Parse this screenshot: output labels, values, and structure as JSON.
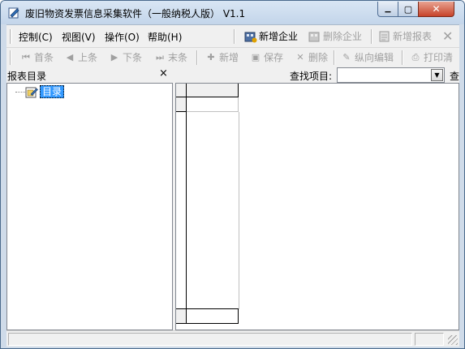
{
  "window": {
    "title": "废旧物资发票信息采集软件（一般纳税人版） V1.1",
    "caption_buttons": {
      "minimize": "▁",
      "maximize": "▢",
      "close": "✕"
    }
  },
  "menu": [
    {
      "label": "控制(C)"
    },
    {
      "label": "视图(V)"
    },
    {
      "label": "操作(O)"
    },
    {
      "label": "帮助(H)"
    }
  ],
  "toolbar1": [
    {
      "label": "新增企业",
      "icon": "new-company-icon",
      "enabled": true
    },
    {
      "label": "删除企业",
      "icon": "delete-company-icon",
      "enabled": false
    },
    {
      "label": "新增报表",
      "icon": "new-report-icon",
      "enabled": false
    },
    {
      "label": "✕",
      "icon": "close-icon",
      "enabled": false
    }
  ],
  "toolbar2": [
    {
      "label": "首条",
      "icon": "first-record-icon",
      "glyph": "⏮"
    },
    {
      "label": "上条",
      "icon": "prev-record-icon",
      "glyph": "◀"
    },
    {
      "label": "下条",
      "icon": "next-record-icon",
      "glyph": "▶"
    },
    {
      "label": "末条",
      "icon": "last-record-icon",
      "glyph": "⏭"
    },
    {
      "label": "新增",
      "icon": "add-icon",
      "glyph": "✚"
    },
    {
      "label": "保存",
      "icon": "save-icon",
      "glyph": "▣"
    },
    {
      "label": "删除",
      "icon": "delete-icon",
      "glyph": "✕"
    },
    {
      "label": "纵向编辑",
      "icon": "vertical-edit-icon",
      "glyph": "✎"
    },
    {
      "label": "打印清",
      "icon": "print-icon",
      "glyph": "⎙"
    }
  ],
  "left_panel": {
    "title": "报表目录",
    "close": "×",
    "tree_root": "目录"
  },
  "find": {
    "label": "查找项目:",
    "value": "",
    "tail": "查"
  },
  "colors": {
    "window_frame": "#cfdbe9",
    "selection": "#3399ff",
    "disabled_text": "#a0a0a0"
  }
}
